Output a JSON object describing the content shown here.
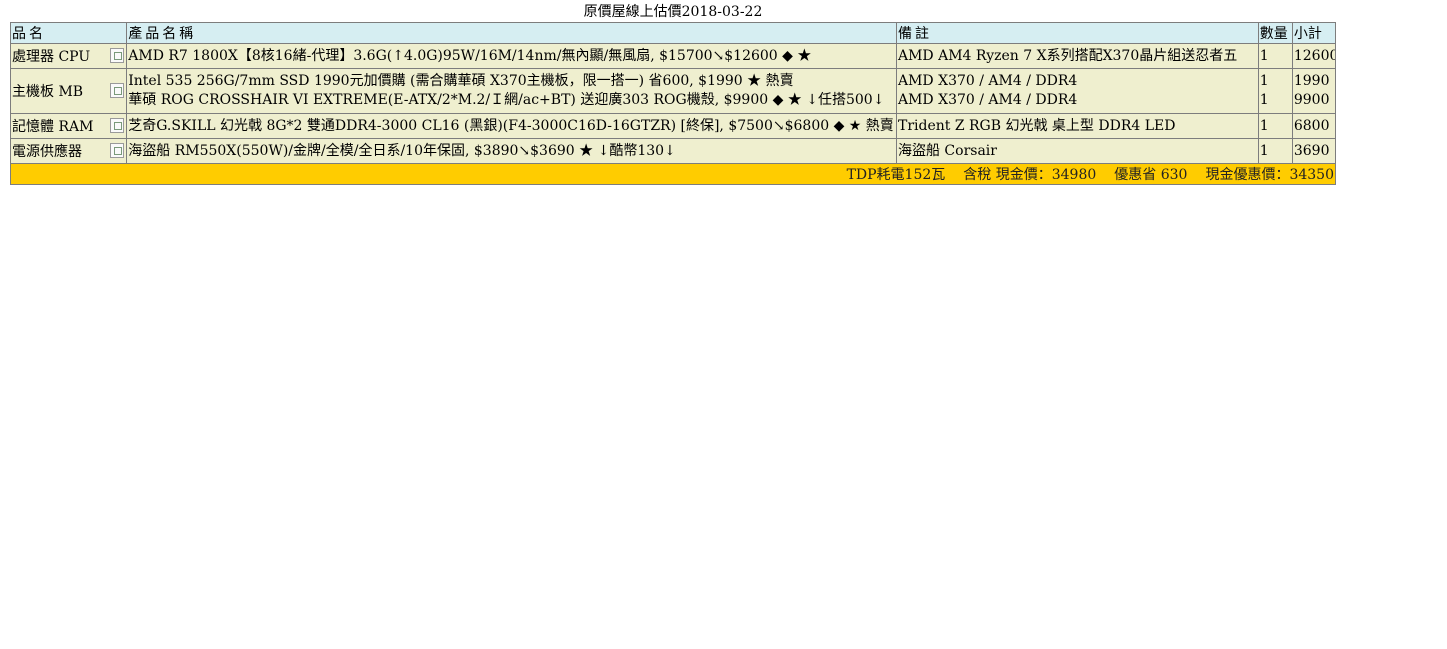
{
  "title": "原價屋線上估價2018-03-22",
  "headers": {
    "category": "品名",
    "product": "產品名稱",
    "note": "備註",
    "qty": "數量",
    "subtotal": "小計"
  },
  "rows": [
    {
      "category": "處理器 CPU",
      "products": [
        "AMD R7 1800X【8核16緒-代理】3.6G(↑4.0G)95W/16M/14nm/無內顯/無風扇, $15700↘$12600 ◆ ★"
      ],
      "notes": [
        "AMD AM4 Ryzen 7 X系列搭配X370晶片組送忍者五"
      ],
      "qty": [
        "1"
      ],
      "subtotal": [
        "12600"
      ]
    },
    {
      "category": "主機板 MB",
      "products": [
        "Intel 535 256G/7mm SSD 1990元加價購 (需合購華碩 X370主機板，限一搭一) 省600, $1990 ★ 熱賣",
        "華碩 ROG CROSSHAIR VI EXTREME(E-ATX/2*M.2/Ｉ網/ac+BT) 送迎廣303 ROG機殼, $9900 ◆ ★ ↓任搭500↓"
      ],
      "notes": [
        "AMD X370 / AM4 / DDR4",
        "AMD X370 / AM4 / DDR4"
      ],
      "qty": [
        "1",
        "1"
      ],
      "subtotal": [
        "1990",
        "9900"
      ]
    },
    {
      "category": "記憶體 RAM",
      "products": [
        "芝奇G.SKILL 幻光戟 8G*2 雙通DDR4-3000 CL16 (黑銀)(F4-3000C16D-16GTZR) [終保], $7500↘$6800 ◆ ★ 熱賣"
      ],
      "notes": [
        "Trident Z RGB 幻光戟 桌上型 DDR4 LED"
      ],
      "qty": [
        "1"
      ],
      "subtotal": [
        "6800"
      ]
    },
    {
      "category": "電源供應器",
      "products": [
        "海盜船 RM550X(550W)/金牌/全模/全日系/10年保固, $3890↘$3690 ★ ↓酷幣130↓"
      ],
      "notes": [
        "海盜船 Corsair"
      ],
      "qty": [
        "1"
      ],
      "subtotal": [
        "3690"
      ]
    }
  ],
  "totals": {
    "tdp": "TDP耗電152瓦",
    "cash": "含稅 現金價：34980",
    "saved": "優惠省 630",
    "discount": "現金優惠價：34350"
  }
}
